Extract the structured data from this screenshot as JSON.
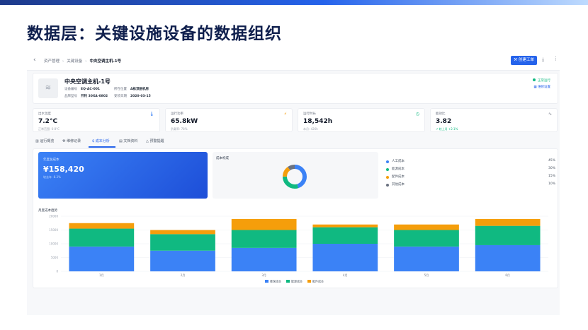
{
  "slide": {
    "title": "数据层：关键设施设备的数据组织"
  },
  "toolbar": {
    "back_glyph": "‹",
    "breadcrumb": [
      "资产管理",
      "关键设备",
      "中央空调主机-1号"
    ],
    "create_button": "创建工单",
    "download_glyph": "⤓",
    "more_glyph": "⋮"
  },
  "equipment": {
    "icon_glyph": "≋",
    "name": "中央空调主机-1号",
    "fields": [
      {
        "label": "设备编号",
        "value": "EQ-AC-001"
      },
      {
        "label": "所在位置",
        "value": "A栋顶层机房"
      },
      {
        "label": "品牌型号",
        "value": "开利 30XA-0802"
      },
      {
        "label": "安装日期",
        "value": "2020-03-15"
      }
    ],
    "status": "正常运行",
    "maintenance_link": "维修设置"
  },
  "metrics": [
    {
      "label": "出水温度",
      "value": "7.2°C",
      "sub": "正常范围: 6-8°C",
      "icon": "🌡",
      "icon_color": "#3b82f6"
    },
    {
      "label": "运行功率",
      "value": "65.8kW",
      "sub": "负载率: 78%",
      "icon": "⚡",
      "icon_color": "#f59e0b"
    },
    {
      "label": "运行时长",
      "value": "18,542h",
      "sub": "本月: 426h",
      "icon": "◷",
      "icon_color": "#10b981"
    },
    {
      "label": "能效比",
      "value": "3.82",
      "sub": "↗ 较上月 +2.1%",
      "icon": "∿",
      "icon_color": "#6b7280"
    }
  ],
  "tabs": [
    {
      "label": "运行概览",
      "icon": "▥"
    },
    {
      "label": "维修记录",
      "icon": "⚒"
    },
    {
      "label": "成本分析",
      "icon": "$",
      "active": true
    },
    {
      "label": "文档资料",
      "icon": "▤"
    },
    {
      "label": "预警提醒",
      "icon": "△"
    }
  ],
  "cost": {
    "total_label": "年度总成本",
    "total_value": "¥158,420",
    "total_sub": "较去年 -8.3%",
    "composition_label": "成本构成",
    "trend_label": "月度成本趋势"
  },
  "colors": {
    "accent": "#2563eb",
    "green": "#10b981",
    "orange": "#f59e0b",
    "gray": "#6b7280"
  },
  "chart_data": [
    {
      "type": "pie",
      "title": "成本构成",
      "labels": [
        "人工成本",
        "能源成本",
        "配件成本",
        "其他成本"
      ],
      "values": [
        45,
        30,
        15,
        10
      ],
      "colors": [
        "#3b82f6",
        "#10b981",
        "#f59e0b",
        "#6b7280"
      ],
      "legend_values": [
        "45%",
        "30%",
        "15%",
        "10%"
      ],
      "legend_position": "right"
    },
    {
      "type": "bar",
      "stacked": true,
      "title": "月度成本趋势",
      "categories": [
        "1月",
        "2月",
        "3月",
        "4月",
        "5月",
        "6月"
      ],
      "series": [
        {
          "name": "维保成本",
          "color": "#3b82f6",
          "values": [
            9000,
            7500,
            8500,
            10000,
            9000,
            9500
          ]
        },
        {
          "name": "能源成本",
          "color": "#10b981",
          "values": [
            6500,
            6000,
            6500,
            6000,
            6000,
            7000
          ]
        },
        {
          "name": "配件成本",
          "color": "#f59e0b",
          "values": [
            2000,
            1500,
            4000,
            1000,
            2000,
            2500
          ]
        }
      ],
      "yticks": [
        "20000",
        "15000",
        "10000",
        "5000",
        "0"
      ],
      "ylim": [
        0,
        20000
      ],
      "grid": true,
      "legend_position": "bottom"
    }
  ]
}
